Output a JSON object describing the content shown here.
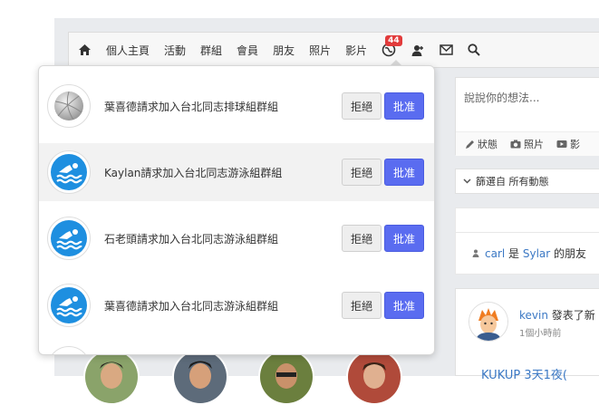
{
  "nav": {
    "items": [
      "個人主頁",
      "活動",
      "群組",
      "會員",
      "朋友",
      "照片",
      "影片"
    ],
    "notification_count": "44"
  },
  "post_box": {
    "placeholder": "說說你的想法...",
    "actions": [
      "狀態",
      "照片",
      "影"
    ]
  },
  "filter": {
    "label": "篩選自 所有動態"
  },
  "friend_activity": {
    "user1": "carl",
    "connector": " 是 ",
    "user2": "Sylar",
    "suffix": " 的朋友"
  },
  "feed": {
    "author": "kevin",
    "action": " 發表了新",
    "time": "1個小時前",
    "partial_title": "KUKUP 3天1夜("
  },
  "requests": [
    {
      "text": "葉喜德請求加入台北同志排球組群組",
      "icon": "volleyball-icon"
    },
    {
      "text": "Kaylan請求加入台北同志游泳組群組",
      "icon": "swimming-icon"
    },
    {
      "text": "石老頭請求加入台北同志游泳組群組",
      "icon": "swimming-icon"
    },
    {
      "text": "葉喜德請求加入台北同志游泳組群組",
      "icon": "swimming-icon"
    }
  ],
  "buttons": {
    "reject": "拒絕",
    "approve": "批准"
  },
  "colors": {
    "approve": "#5a6cf0",
    "badge": "#e23b3b",
    "link": "#3b78c4",
    "swim_blue": "#1e8fe0"
  }
}
